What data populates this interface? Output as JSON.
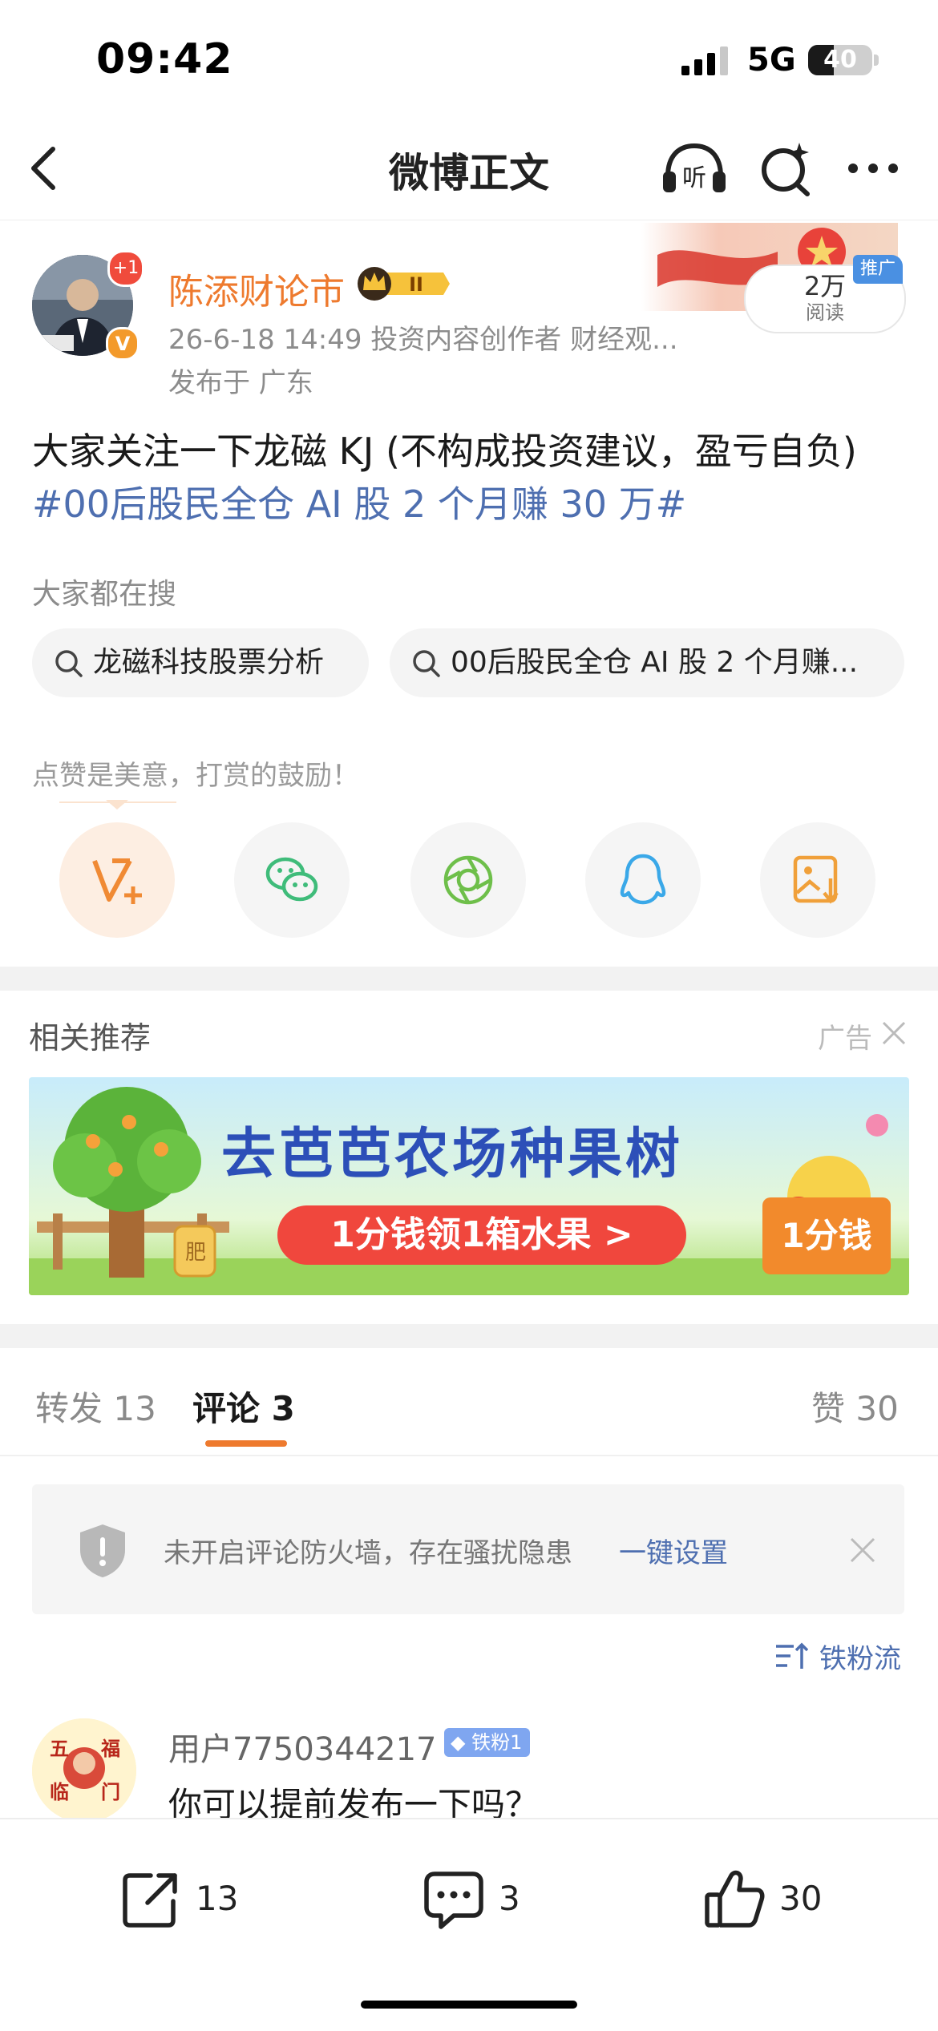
{
  "status_bar": {
    "time": "09:42",
    "network": "5G",
    "battery": "40",
    "battery_level": 0.4
  },
  "nav": {
    "title": "微博正文",
    "icons": [
      "back-arrow-icon",
      "listen-headphones-icon",
      "refresh-sparkle-icon",
      "more-dots-icon"
    ]
  },
  "author": {
    "name": "陈添财论市",
    "notif_badge": "+1",
    "verified_badge": "V",
    "level_badge": "II",
    "meta": "26-6-18 14:49  投资内容创作者 财经观...",
    "location": "发布于 广东",
    "read_count": "2万",
    "read_label": "阅读",
    "promo_tag": "推广"
  },
  "post": {
    "text": "大家关注一下龙磁 KJ (不构成投资建议，盈亏自负)",
    "hashtag": "#00后股民全仓 AI 股 2 个月赚 30 万#"
  },
  "search": {
    "heading": "大家都在搜",
    "chips": [
      "龙磁科技股票分析",
      "00后股民全仓 AI 股 2 个月赚..."
    ]
  },
  "reward": {
    "text": "点赞是美意，打赏的鼓励！",
    "share_buttons": [
      "v-plus-icon",
      "wechat-icon",
      "moments-icon",
      "qq-icon",
      "save-image-icon"
    ]
  },
  "recommend": {
    "title": "相关推荐",
    "ad_label": "广告",
    "banner": {
      "title": "去芭芭农场种果树",
      "cta": "1分钱领1箱水果 >",
      "price": "1分钱",
      "barrel": "肥"
    }
  },
  "tabs": {
    "repost": "转发 13",
    "comment": "评论 3",
    "like": "赞 30"
  },
  "firewall": {
    "text": "未开启评论防火墙，存在骚扰隐患",
    "link": "一键设置"
  },
  "sort": {
    "label": "铁粉流"
  },
  "comment": {
    "user": "用户7750344217",
    "fan_badge": "铁粉1",
    "text": "你可以提前发布一下吗？",
    "avatar_chars": [
      "五",
      "福",
      "临",
      "门"
    ]
  },
  "bottom_bar": {
    "repost": "13",
    "comment": "3",
    "like": "30"
  },
  "colors": {
    "accent": "#ee7a2e",
    "link": "#4e6fb0",
    "muted": "#8c8c8c"
  }
}
